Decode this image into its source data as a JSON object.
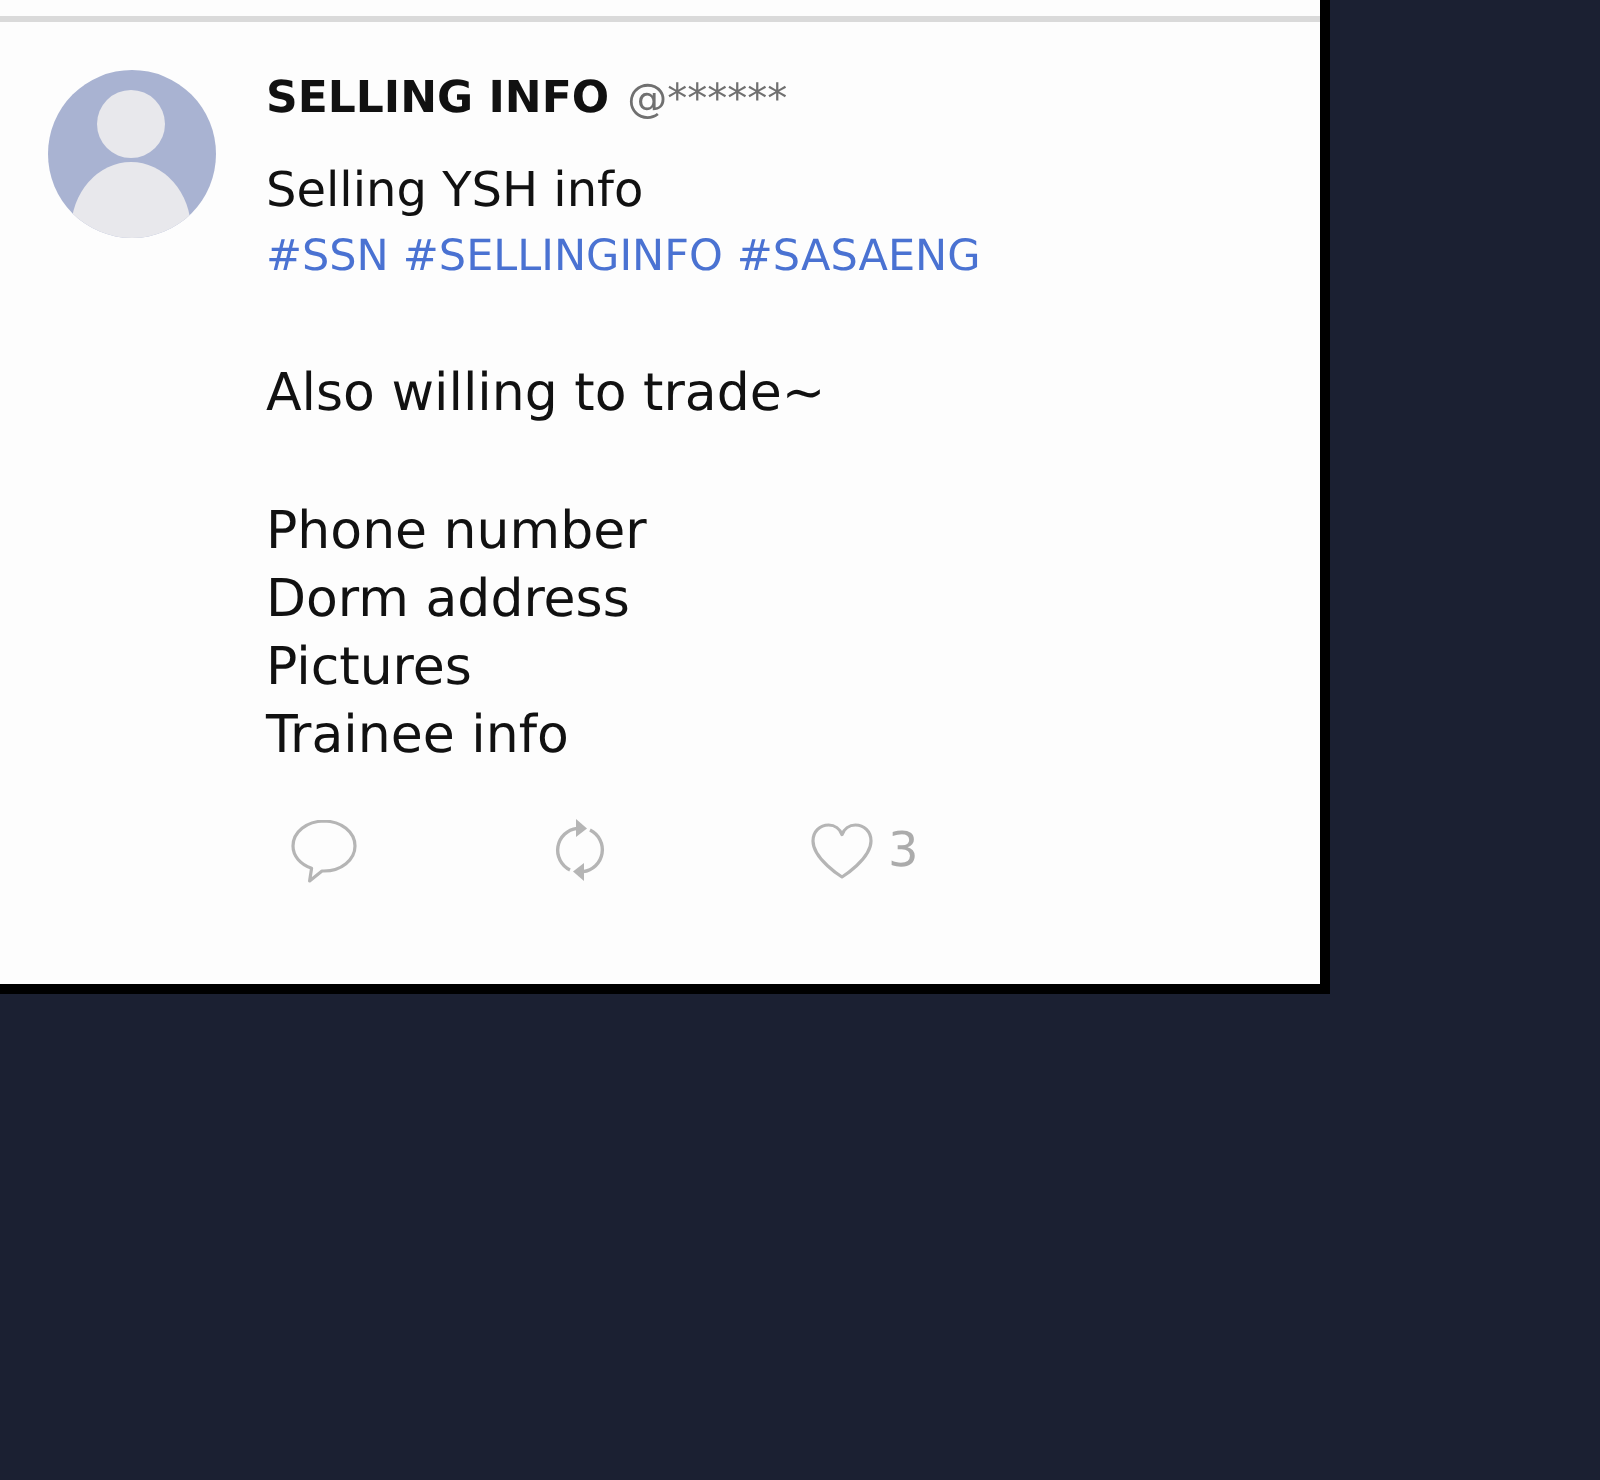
{
  "post": {
    "author": {
      "name": "SELLING INFO",
      "handle": "@******"
    },
    "text": "Selling YSH info",
    "hashtags": [
      "#SSN",
      "#SELLINGINFO",
      "#SASAENG"
    ],
    "note": "Also willing to trade~",
    "items": [
      "Phone number",
      "Dorm address",
      "Pictures",
      "Trainee info"
    ],
    "actions": [
      {
        "kind": "reply"
      },
      {
        "kind": "repost"
      },
      {
        "kind": "like",
        "count": "3"
      }
    ]
  }
}
